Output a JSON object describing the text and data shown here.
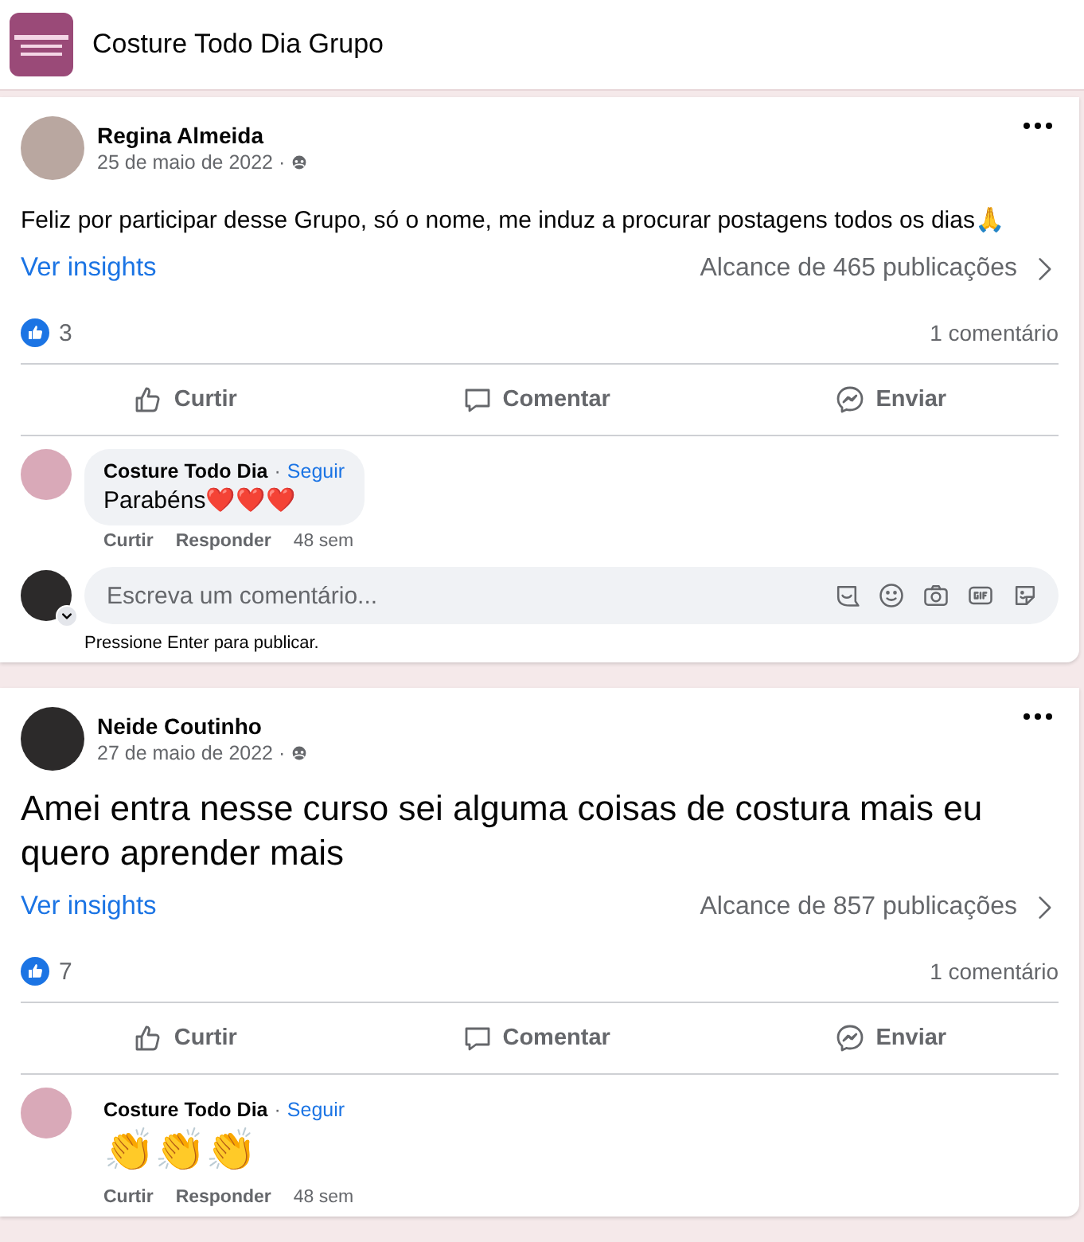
{
  "header": {
    "title": "Costure Todo Dia Grupo"
  },
  "posts": [
    {
      "author": "Regina Almeida",
      "date": "25 de maio de 2022 ·",
      "kind": "normal",
      "text": "Feliz por participar desse Grupo, só o nome, me induz a procurar postagens todos os dias🙏",
      "insights": "Ver insights",
      "reach": "Alcance de 465 publicações",
      "likes": "3",
      "comments_count": "1 comentário",
      "actions": [
        "Curtir",
        "Comentar",
        "Enviar"
      ],
      "comments": [
        {
          "author": "Costure Todo Dia",
          "separator": "·",
          "follow": "Seguir",
          "text": "Parabéns❤️❤️❤️",
          "kind": "text",
          "actions": [
            "Curtir",
            "Responder"
          ],
          "time": "48 sem"
        }
      ],
      "composer": {
        "placeholder": "Escreva um comentário...",
        "hint": "Pressione Enter para publicar."
      }
    },
    {
      "author": "Neide Coutinho",
      "date": "27 de maio de 2022 ·",
      "kind": "large",
      "text": "Amei entra nesse curso sei alguma coisas de costura mais eu quero aprender mais",
      "insights": "Ver insights",
      "reach": "Alcance de 857 publicações",
      "likes": "7",
      "comments_count": "1 comentário",
      "actions": [
        "Curtir",
        "Comentar",
        "Enviar"
      ],
      "comments": [
        {
          "author": "Costure Todo Dia",
          "separator": "·",
          "follow": "Seguir",
          "text": "👏👏👏",
          "kind": "emoji",
          "actions": [
            "Curtir",
            "Responder"
          ],
          "time": "48 sem"
        }
      ]
    }
  ]
}
